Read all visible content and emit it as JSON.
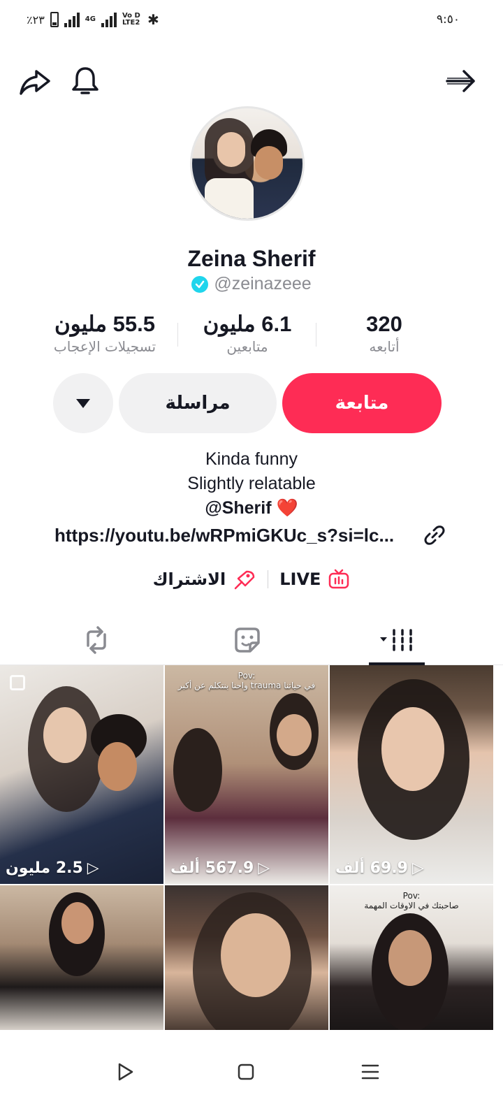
{
  "status_bar": {
    "battery": "٪٢٣",
    "network": "4G",
    "volte": "Vo D LTE2",
    "time": "٩:٥٠"
  },
  "profile": {
    "display_name": "Zeina Sherif",
    "handle": "@zeinazeee",
    "verified": true
  },
  "stats": [
    {
      "value": "55.5 مليون",
      "label": "تسجيلات الإعجاب"
    },
    {
      "value": "6.1 مليون",
      "label": "متابعين"
    },
    {
      "value": "320",
      "label": "أتابعه"
    }
  ],
  "buttons": {
    "follow": "متابعة",
    "message": "مراسلة"
  },
  "bio": {
    "line1": "Kinda funny",
    "line2": "Slightly relatable",
    "mention": "@Sherif",
    "heart": "❤️",
    "link": "https://youtu.be/wRPmiGKUc_s?si=lc..."
  },
  "extras": {
    "subscribe": "الاشتراك",
    "live": "LIVE"
  },
  "videos": [
    {
      "views": "2.5 مليون",
      "caption": ""
    },
    {
      "views": "567.9 ألف",
      "caption": "Pov:\nواحنا بنتكلم عن أكبر trauma في حياتنا"
    },
    {
      "views": "69.9 ألف",
      "caption": ""
    },
    {
      "views": "",
      "caption": ""
    },
    {
      "views": "",
      "caption": ""
    },
    {
      "views": "",
      "caption": "Pov:\nصاحبتك في الاوقات المهمة"
    }
  ],
  "colors": {
    "accent": "#fe2c55",
    "verified": "#20d5ec",
    "secondary_text": "#8a8b91",
    "button_gray": "#f1f1f2"
  }
}
